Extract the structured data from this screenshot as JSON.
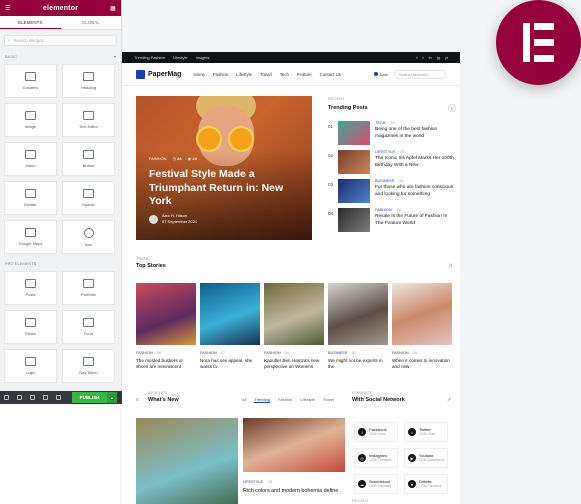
{
  "editor": {
    "logo": "elementor",
    "tabs": [
      "Elements",
      "Global"
    ],
    "search_placeholder": "Search Widget...",
    "basic_label": "Basic",
    "basic_widgets": [
      {
        "label": "Columns",
        "icon": "columns-icon"
      },
      {
        "label": "Heading",
        "icon": "heading-icon"
      },
      {
        "label": "Image",
        "icon": "image-icon"
      },
      {
        "label": "Text Editor",
        "icon": "text-editor-icon"
      },
      {
        "label": "Video",
        "icon": "video-icon"
      },
      {
        "label": "Button",
        "icon": "button-icon"
      },
      {
        "label": "Divider",
        "icon": "divider-icon"
      },
      {
        "label": "Spacer",
        "icon": "spacer-icon"
      },
      {
        "label": "Google Maps",
        "icon": "map-icon"
      },
      {
        "label": "Icon",
        "icon": "star-icon"
      }
    ],
    "pro_label": "Pro Elements",
    "pro_widgets": [
      {
        "label": "Posts",
        "icon": "posts-icon"
      },
      {
        "label": "Portfolio",
        "icon": "portfolio-icon"
      },
      {
        "label": "Slides",
        "icon": "slides-icon"
      },
      {
        "label": "Form",
        "icon": "form-icon"
      },
      {
        "label": "Login",
        "icon": "login-icon"
      },
      {
        "label": "Nav Menu",
        "icon": "nav-menu-icon"
      }
    ],
    "publish_label": "PUBLISH",
    "accent": "#93003c"
  },
  "site": {
    "topbar_links": [
      "Trending Fashion",
      "Lifestyle",
      "Insights"
    ],
    "social": [
      "f",
      "t",
      "in",
      "ig",
      "yt"
    ],
    "brand": "PaperMag",
    "menu": [
      "Home",
      "Fashion",
      "Lifestyle",
      "Travel",
      "Tech",
      "Feature",
      "Contact Us"
    ],
    "dark_label": "Dark",
    "search_placeholder": "Search keyword...",
    "hero": {
      "category": "FASHION",
      "stats": "24",
      "views": "24",
      "title": "Festival Style Made a Triumphant Return in: New York",
      "author": "Alex H. Hilson",
      "date": "07 September 2021"
    },
    "trending": {
      "sub": "Recent",
      "title": "Trending Posts",
      "items": [
        {
          "num": "01",
          "cat": "TECH",
          "meta": "24",
          "title": "Being one of the best fashion magazines in the world"
        },
        {
          "num": "02",
          "cat": "LIFESTYLE",
          "meta": "24",
          "title": "The Iconic Iris Apfel Marks Her 100th Birthday With a New"
        },
        {
          "num": "03",
          "cat": "BUSINESS",
          "meta": "24",
          "title": "For those who are fashion conscious and looking for something"
        },
        {
          "num": "04",
          "cat": "FASHION",
          "meta": "24",
          "title": "Resale Is the Future of Fashion In The Feature World"
        }
      ]
    },
    "stories": {
      "sub": "Trend",
      "title": "Top Stories",
      "cards": [
        {
          "cat": "FASHION",
          "meta": "24",
          "title": "The molded bustiers or shoes are reminiscent"
        },
        {
          "cat": "FASHION",
          "meta": "17",
          "title": "Nora has sex appeal, she wants to"
        },
        {
          "cat": "FASHION",
          "meta": "24",
          "title": "Kaoufler Ben Hamza's new perspective on Womens"
        },
        {
          "cat": "BUSINESS",
          "meta": "16",
          "title": "We might not be experts in the"
        },
        {
          "cat": "FASHION",
          "meta": "24",
          "title": "When it comes to innovation and new"
        }
      ]
    },
    "whatsnew": {
      "sub": "Insights",
      "title": "What's New",
      "tabs": [
        "All",
        "Trending",
        "Fashion",
        "Lifestyle",
        "Travel"
      ],
      "active_tab": "Trending",
      "post_cat": "LIFESTYLE",
      "post_meta": "24",
      "post_title": "Rich colors and modern bohemia define"
    },
    "connect": {
      "sub": "Connect",
      "title": "With Social Network",
      "items": [
        {
          "name": "Facebook",
          "count": "13.5k Likes"
        },
        {
          "name": "Twitter",
          "count": "13.5k Likes"
        },
        {
          "name": "Instagram",
          "count": "14.5k Followers"
        },
        {
          "name": "Youtube",
          "count": "13.5k Subscribers"
        },
        {
          "name": "Soundcloud",
          "count": "13.5k Followers"
        },
        {
          "name": "Dribble",
          "count": "13.5k Followers"
        }
      ]
    },
    "recent_label": "Recent"
  }
}
